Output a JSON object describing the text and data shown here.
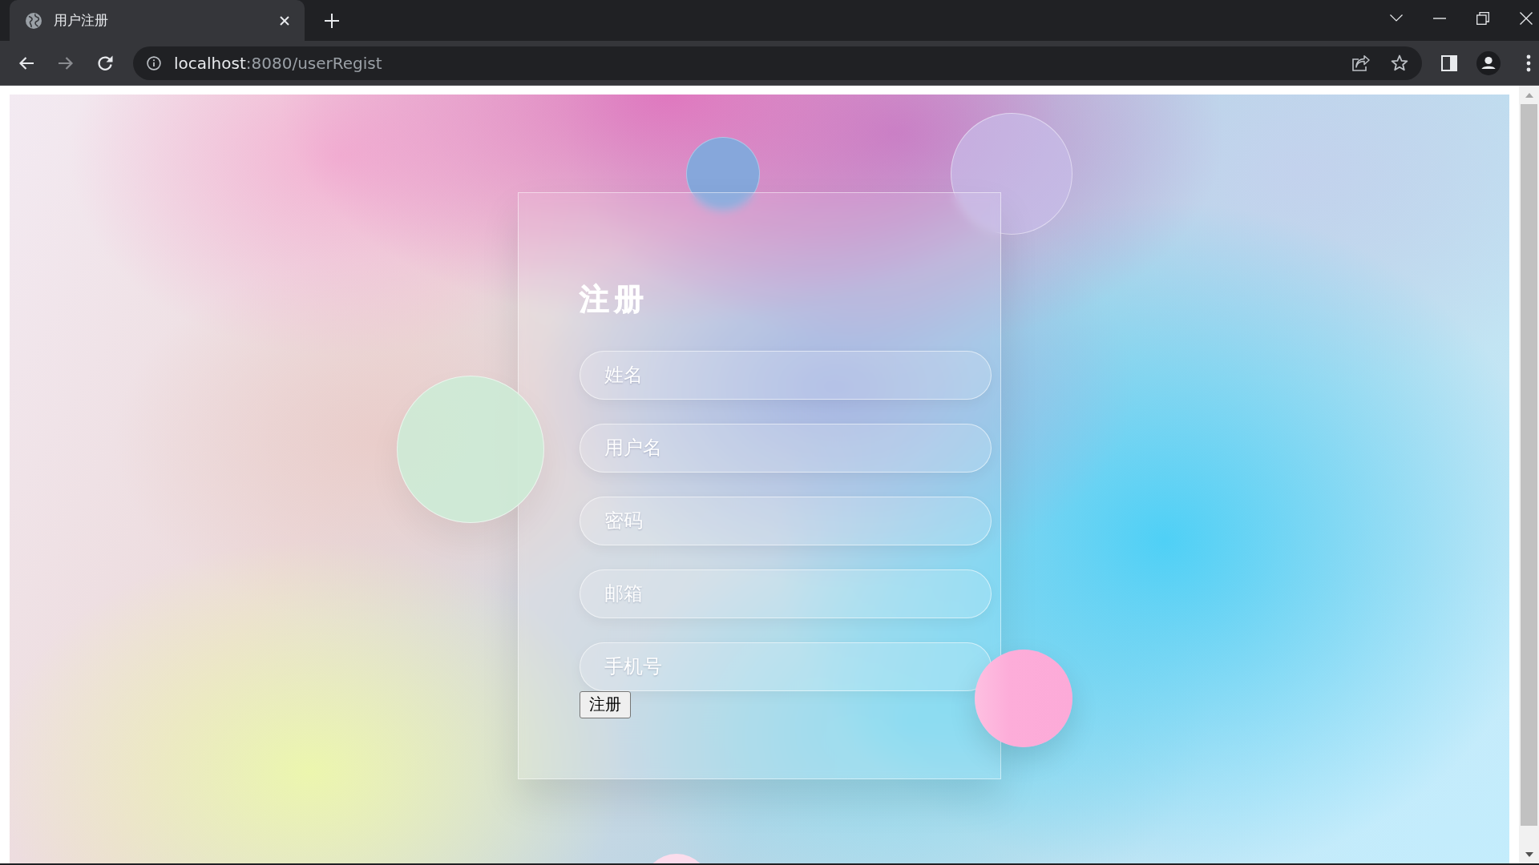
{
  "browser": {
    "tabs": [
      {
        "title": "用户注册",
        "selected": true
      }
    ],
    "nav": [
      {
        "kind": "back",
        "disabled": false
      },
      {
        "kind": "forward",
        "disabled": true
      },
      {
        "kind": "reload",
        "disabled": false
      }
    ],
    "url": {
      "host": "localhost",
      "port_path": ":8080/userRegist"
    }
  },
  "form": {
    "title": "注册",
    "fields": [
      {
        "placeholder": "姓名"
      },
      {
        "placeholder": "用户名"
      },
      {
        "placeholder": "密码"
      },
      {
        "placeholder": "邮箱"
      },
      {
        "placeholder": "手机号"
      }
    ],
    "submit": "注册"
  }
}
